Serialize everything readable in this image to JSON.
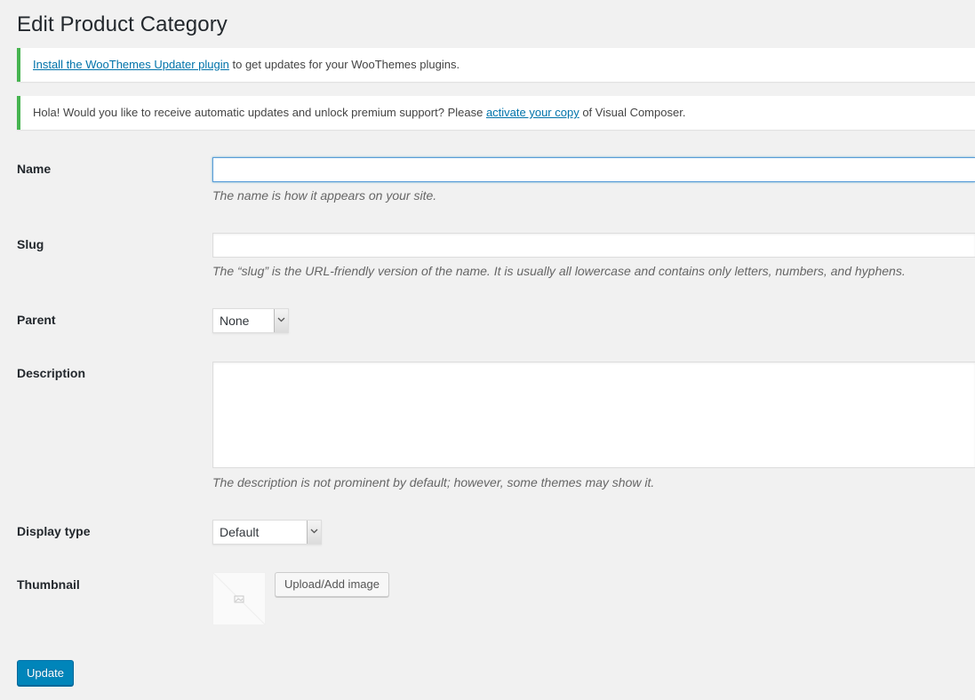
{
  "page": {
    "title": "Edit Product Category"
  },
  "notices": [
    {
      "link_text": "Install the WooThemes Updater plugin",
      "text_after": " to get updates for your WooThemes plugins."
    },
    {
      "text_before": "Hola! Would you like to receive automatic updates and unlock premium support? Please ",
      "link_text": "activate your copy",
      "text_after": " of Visual Composer."
    }
  ],
  "form": {
    "name": {
      "label": "Name",
      "value": "",
      "help": "The name is how it appears on your site."
    },
    "slug": {
      "label": "Slug",
      "value": "",
      "help": "The “slug” is the URL-friendly version of the name. It is usually all lowercase and contains only letters, numbers, and hyphens."
    },
    "parent": {
      "label": "Parent",
      "selected": "None"
    },
    "description": {
      "label": "Description",
      "value": "",
      "help": "The description is not prominent by default; however, some themes may show it."
    },
    "display_type": {
      "label": "Display type",
      "selected": "Default"
    },
    "thumbnail": {
      "label": "Thumbnail",
      "upload_label": "Upload/Add image"
    },
    "submit_label": "Update"
  },
  "colors": {
    "notice_border": "#46b450",
    "link": "#0073aa",
    "primary_button": "#0085ba",
    "background": "#f1f1f1"
  },
  "icons": {
    "select_arrow": "chevron-down-icon",
    "thumbnail_placeholder": "placeholder-image-icon"
  }
}
